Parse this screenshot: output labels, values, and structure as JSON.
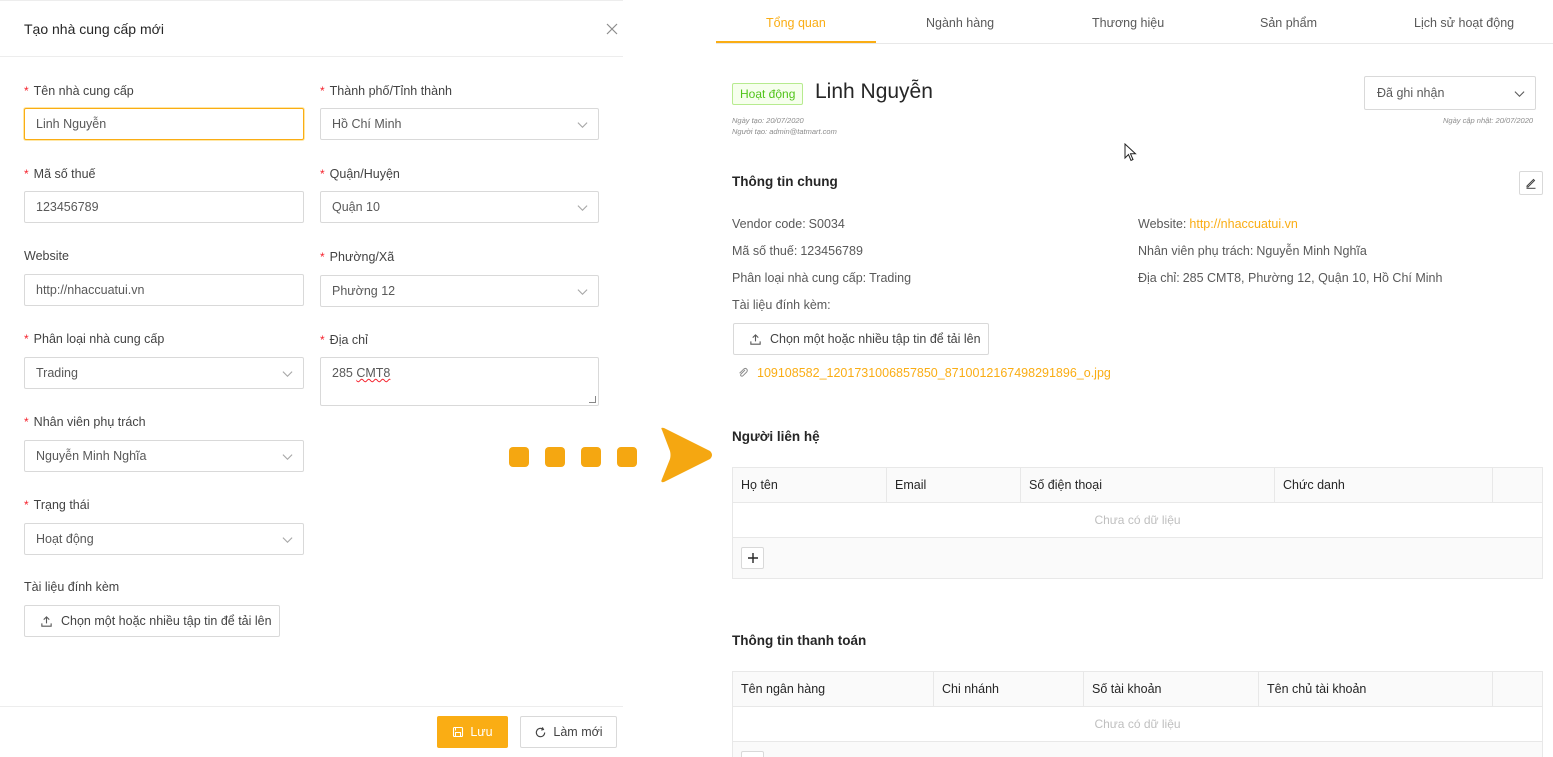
{
  "form": {
    "title": "Tạo nhà cung cấp mới",
    "fields": {
      "vendor_name": {
        "label": "Tên nhà cung cấp",
        "value": "Linh Nguyễn"
      },
      "city": {
        "label": "Thành phố/Tỉnh thành",
        "value": "Hồ Chí Minh"
      },
      "tax_code": {
        "label": "Mã số thuế",
        "value": "123456789"
      },
      "district": {
        "label": "Quận/Huyện",
        "value": "Quận 10"
      },
      "website": {
        "label": "Website",
        "value": "http://nhaccuatui.vn"
      },
      "ward": {
        "label": "Phường/Xã",
        "value": "Phường 12"
      },
      "vendor_type": {
        "label": "Phân loại nhà cung cấp",
        "value": "Trading"
      },
      "address": {
        "label": "Địa chỉ",
        "value_word1": "285",
        "value_word2": "CMT8"
      },
      "staff": {
        "label": "Nhân viên phụ trách",
        "value": "Nguyễn Minh Nghĩa"
      },
      "status": {
        "label": "Trạng thái",
        "value": "Hoạt động"
      },
      "attachments": {
        "label": "Tài liệu đính kèm",
        "button": "Chọn một hoặc nhiều tập tin để tải lên"
      }
    },
    "required_mark": "*",
    "save_label": "Lưu",
    "reset_label": "Làm mới"
  },
  "detail": {
    "tabs": [
      "Tổng quan",
      "Ngành hàng",
      "Thương hiệu",
      "Sản phẩm",
      "Lịch sử hoạt động"
    ],
    "active_tab": "Tổng quan",
    "status_tag": "Hoạt động",
    "vendor_name": "Linh Nguyễn",
    "created_date": "Ngày tạo: 20/07/2020",
    "created_by": "Người tạo: admin@tatmart.com",
    "updated_date": "Ngày cập nhật: 20/07/2020",
    "record_status": "Đã ghi nhận",
    "general": {
      "title": "Thông tin chung",
      "vendor_code_label": "Vendor code:",
      "vendor_code": "S0034",
      "tax_code_label": "Mã số thuế:",
      "tax_code": "123456789",
      "type_label": "Phân loại nhà cung cấp:",
      "type": "Trading",
      "attachments_label": "Tài liệu đính kèm:",
      "website_label": "Website:",
      "website": "http://nhaccuatui.vn",
      "staff_label": "Nhân viên phụ trách:",
      "staff": "Nguyễn Minh Nghĩa",
      "address_label": "Địa chỉ:",
      "address": "285 CMT8, Phường 12, Quận 10, Hồ Chí Minh",
      "upload_button": "Chọn một hoặc nhiều tập tin để tải lên",
      "file_name": "109108582_1201731006857850_8710012167498291896_o.jpg"
    },
    "contacts": {
      "title": "Người liên hệ",
      "columns": [
        "Họ tên",
        "Email",
        "Số điện thoại",
        "Chức danh"
      ],
      "empty": "Chưa có dữ liệu"
    },
    "payment": {
      "title": "Thông tin thanh toán",
      "columns": [
        "Tên ngân hàng",
        "Chi nhánh",
        "Số tài khoản",
        "Tên chủ tài khoản"
      ],
      "empty": "Chưa có dữ liệu"
    }
  },
  "colors": {
    "accent": "#faad14",
    "active_tag_text": "#52c41a",
    "required": "#f5222d"
  }
}
